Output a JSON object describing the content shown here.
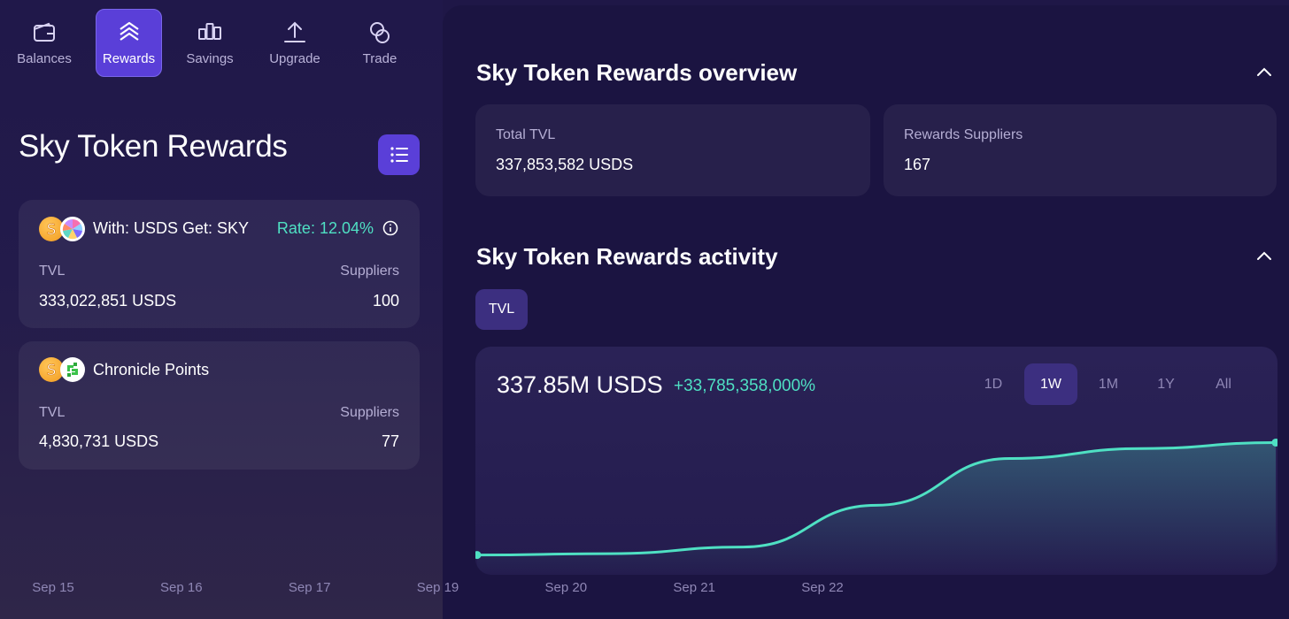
{
  "nav": {
    "items": [
      {
        "label": "Balances",
        "icon": "wallet-icon"
      },
      {
        "label": "Rewards",
        "icon": "rewards-chevrons-icon",
        "active": true
      },
      {
        "label": "Savings",
        "icon": "savings-icon"
      },
      {
        "label": "Upgrade",
        "icon": "upgrade-icon"
      },
      {
        "label": "Trade",
        "icon": "trade-icon"
      }
    ]
  },
  "sidebar": {
    "title": "Sky Token Rewards",
    "list_button_icon": "list-icon",
    "cards": [
      {
        "title": "With: USDS Get: SKY",
        "rate": "Rate: 12.04%",
        "tvl_label": "TVL",
        "tvl_value": "333,022,851 USDS",
        "suppliers_label": "Suppliers",
        "suppliers_value": "100"
      },
      {
        "title": "Chronicle Points",
        "tvl_label": "TVL",
        "tvl_value": "4,830,731 USDS",
        "suppliers_label": "Suppliers",
        "suppliers_value": "77"
      }
    ]
  },
  "overview": {
    "title": "Sky Token Rewards overview",
    "total_tvl_label": "Total TVL",
    "total_tvl_value": "337,853,582 USDS",
    "suppliers_label": "Rewards Suppliers",
    "suppliers_value": "167"
  },
  "activity": {
    "title": "Sky Token Rewards activity",
    "tab_label": "TVL",
    "value": "337.85M USDS",
    "change": "+33,785,358,000%",
    "ranges": [
      "1D",
      "1W",
      "1M",
      "1Y",
      "All"
    ],
    "active_range": "1W"
  },
  "colors": {
    "accent": "#5a3fd8",
    "teal": "#4fe0c3",
    "panel": "#1b1441"
  },
  "chart_data": {
    "type": "area",
    "x": [
      "Sep 15",
      "Sep 16",
      "Sep 17",
      "Sep 19",
      "Sep 20",
      "Sep 21",
      "Sep 22"
    ],
    "values": [
      1,
      5,
      25,
      150,
      290,
      320,
      337.85
    ],
    "ylim": [
      0,
      400
    ],
    "grid": false,
    "series": [
      {
        "values": [
          1,
          5,
          25,
          150,
          290,
          320,
          337.85
        ]
      }
    ]
  }
}
